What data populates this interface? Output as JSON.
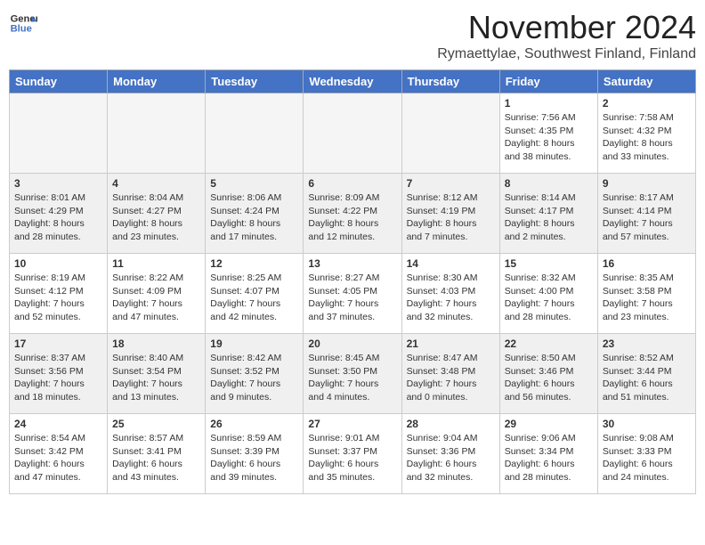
{
  "logo": {
    "line1": "General",
    "line2": "Blue"
  },
  "title": {
    "month": "November 2024",
    "location": "Rymaettylae, Southwest Finland, Finland"
  },
  "weekdays": [
    "Sunday",
    "Monday",
    "Tuesday",
    "Wednesday",
    "Thursday",
    "Friday",
    "Saturday"
  ],
  "weeks": [
    [
      {
        "day": "",
        "info": ""
      },
      {
        "day": "",
        "info": ""
      },
      {
        "day": "",
        "info": ""
      },
      {
        "day": "",
        "info": ""
      },
      {
        "day": "",
        "info": ""
      },
      {
        "day": "1",
        "info": "Sunrise: 7:56 AM\nSunset: 4:35 PM\nDaylight: 8 hours and 38 minutes."
      },
      {
        "day": "2",
        "info": "Sunrise: 7:58 AM\nSunset: 4:32 PM\nDaylight: 8 hours and 33 minutes."
      }
    ],
    [
      {
        "day": "3",
        "info": "Sunrise: 8:01 AM\nSunset: 4:29 PM\nDaylight: 8 hours and 28 minutes."
      },
      {
        "day": "4",
        "info": "Sunrise: 8:04 AM\nSunset: 4:27 PM\nDaylight: 8 hours and 23 minutes."
      },
      {
        "day": "5",
        "info": "Sunrise: 8:06 AM\nSunset: 4:24 PM\nDaylight: 8 hours and 17 minutes."
      },
      {
        "day": "6",
        "info": "Sunrise: 8:09 AM\nSunset: 4:22 PM\nDaylight: 8 hours and 12 minutes."
      },
      {
        "day": "7",
        "info": "Sunrise: 8:12 AM\nSunset: 4:19 PM\nDaylight: 8 hours and 7 minutes."
      },
      {
        "day": "8",
        "info": "Sunrise: 8:14 AM\nSunset: 4:17 PM\nDaylight: 8 hours and 2 minutes."
      },
      {
        "day": "9",
        "info": "Sunrise: 8:17 AM\nSunset: 4:14 PM\nDaylight: 7 hours and 57 minutes."
      }
    ],
    [
      {
        "day": "10",
        "info": "Sunrise: 8:19 AM\nSunset: 4:12 PM\nDaylight: 7 hours and 52 minutes."
      },
      {
        "day": "11",
        "info": "Sunrise: 8:22 AM\nSunset: 4:09 PM\nDaylight: 7 hours and 47 minutes."
      },
      {
        "day": "12",
        "info": "Sunrise: 8:25 AM\nSunset: 4:07 PM\nDaylight: 7 hours and 42 minutes."
      },
      {
        "day": "13",
        "info": "Sunrise: 8:27 AM\nSunset: 4:05 PM\nDaylight: 7 hours and 37 minutes."
      },
      {
        "day": "14",
        "info": "Sunrise: 8:30 AM\nSunset: 4:03 PM\nDaylight: 7 hours and 32 minutes."
      },
      {
        "day": "15",
        "info": "Sunrise: 8:32 AM\nSunset: 4:00 PM\nDaylight: 7 hours and 28 minutes."
      },
      {
        "day": "16",
        "info": "Sunrise: 8:35 AM\nSunset: 3:58 PM\nDaylight: 7 hours and 23 minutes."
      }
    ],
    [
      {
        "day": "17",
        "info": "Sunrise: 8:37 AM\nSunset: 3:56 PM\nDaylight: 7 hours and 18 minutes."
      },
      {
        "day": "18",
        "info": "Sunrise: 8:40 AM\nSunset: 3:54 PM\nDaylight: 7 hours and 13 minutes."
      },
      {
        "day": "19",
        "info": "Sunrise: 8:42 AM\nSunset: 3:52 PM\nDaylight: 7 hours and 9 minutes."
      },
      {
        "day": "20",
        "info": "Sunrise: 8:45 AM\nSunset: 3:50 PM\nDaylight: 7 hours and 4 minutes."
      },
      {
        "day": "21",
        "info": "Sunrise: 8:47 AM\nSunset: 3:48 PM\nDaylight: 7 hours and 0 minutes."
      },
      {
        "day": "22",
        "info": "Sunrise: 8:50 AM\nSunset: 3:46 PM\nDaylight: 6 hours and 56 minutes."
      },
      {
        "day": "23",
        "info": "Sunrise: 8:52 AM\nSunset: 3:44 PM\nDaylight: 6 hours and 51 minutes."
      }
    ],
    [
      {
        "day": "24",
        "info": "Sunrise: 8:54 AM\nSunset: 3:42 PM\nDaylight: 6 hours and 47 minutes."
      },
      {
        "day": "25",
        "info": "Sunrise: 8:57 AM\nSunset: 3:41 PM\nDaylight: 6 hours and 43 minutes."
      },
      {
        "day": "26",
        "info": "Sunrise: 8:59 AM\nSunset: 3:39 PM\nDaylight: 6 hours and 39 minutes."
      },
      {
        "day": "27",
        "info": "Sunrise: 9:01 AM\nSunset: 3:37 PM\nDaylight: 6 hours and 35 minutes."
      },
      {
        "day": "28",
        "info": "Sunrise: 9:04 AM\nSunset: 3:36 PM\nDaylight: 6 hours and 32 minutes."
      },
      {
        "day": "29",
        "info": "Sunrise: 9:06 AM\nSunset: 3:34 PM\nDaylight: 6 hours and 28 minutes."
      },
      {
        "day": "30",
        "info": "Sunrise: 9:08 AM\nSunset: 3:33 PM\nDaylight: 6 hours and 24 minutes."
      }
    ]
  ]
}
